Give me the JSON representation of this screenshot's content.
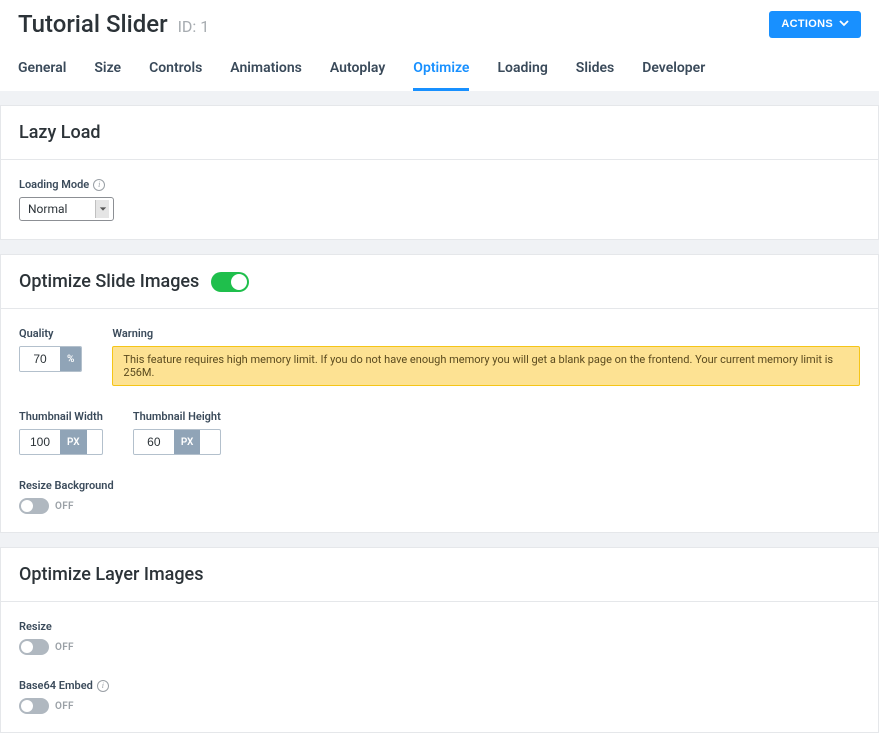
{
  "header": {
    "title": "Tutorial Slider",
    "id_label": "ID: 1",
    "actions_label": "ACTIONS"
  },
  "tabs": [
    {
      "label": "General",
      "active": false
    },
    {
      "label": "Size",
      "active": false
    },
    {
      "label": "Controls",
      "active": false
    },
    {
      "label": "Animations",
      "active": false
    },
    {
      "label": "Autoplay",
      "active": false
    },
    {
      "label": "Optimize",
      "active": true
    },
    {
      "label": "Loading",
      "active": false
    },
    {
      "label": "Slides",
      "active": false
    },
    {
      "label": "Developer",
      "active": false
    }
  ],
  "lazy_load": {
    "section_title": "Lazy Load",
    "loading_mode_label": "Loading Mode",
    "loading_mode_value": "Normal"
  },
  "optimize_slide": {
    "section_title": "Optimize Slide Images",
    "enabled": true,
    "quality_label": "Quality",
    "quality_value": "70",
    "quality_unit": "%",
    "warning_label": "Warning",
    "warning_text": "This feature requires high memory limit. If you do not have enough memory you will get a blank page on the frontend. Your current memory limit is 256M.",
    "thumb_width_label": "Thumbnail Width",
    "thumb_width_value": "100",
    "thumb_height_label": "Thumbnail Height",
    "thumb_height_value": "60",
    "px_unit": "PX",
    "resize_bg_label": "Resize Background",
    "off_label": "OFF"
  },
  "optimize_layer": {
    "section_title": "Optimize Layer Images",
    "resize_label": "Resize",
    "base64_label": "Base64 Embed",
    "off_label": "OFF"
  }
}
